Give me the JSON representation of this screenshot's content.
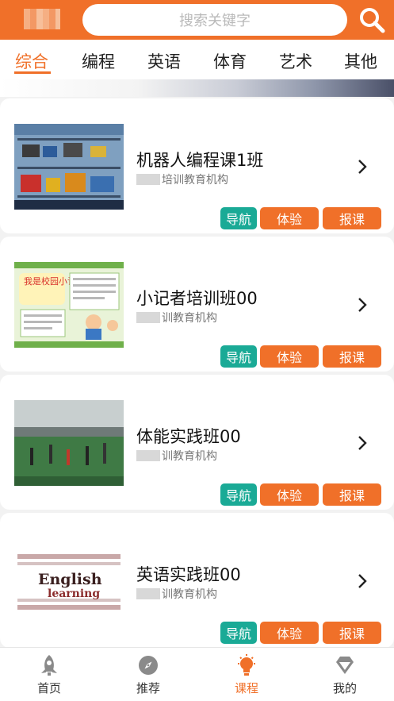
{
  "search": {
    "placeholder": "搜索关键字",
    "icon": "search-icon"
  },
  "tabs": [
    {
      "label": "综合",
      "active": true
    },
    {
      "label": "编程"
    },
    {
      "label": "英语"
    },
    {
      "label": "体育"
    },
    {
      "label": "艺术"
    },
    {
      "label": "其他"
    }
  ],
  "courses": [
    {
      "title": "机器人编程课1班",
      "org_suffix": "培训教育机构"
    },
    {
      "title": "小记者培训班00",
      "org_suffix": "训教育机构"
    },
    {
      "title": "体能实践班00",
      "org_suffix": "训教育机构"
    },
    {
      "title": "英语实践班00",
      "org_suffix": "训教育机构"
    }
  ],
  "course_buttons": {
    "nav": "导航",
    "trial": "体验",
    "enroll": "报课"
  },
  "thumb_text": {
    "reporter": "我是校园小记者!!",
    "english_1": "English",
    "english_2": "learning"
  },
  "bottom_nav": [
    {
      "label": "首页",
      "icon": "rocket-icon"
    },
    {
      "label": "推荐",
      "icon": "compass-icon"
    },
    {
      "label": "课程",
      "icon": "lightbulb-icon",
      "active": true
    },
    {
      "label": "我的",
      "icon": "diamond-icon"
    }
  ],
  "colors": {
    "brand": "#f07029",
    "teal": "#1aaa96",
    "text": "#222222",
    "muted": "#777777"
  }
}
